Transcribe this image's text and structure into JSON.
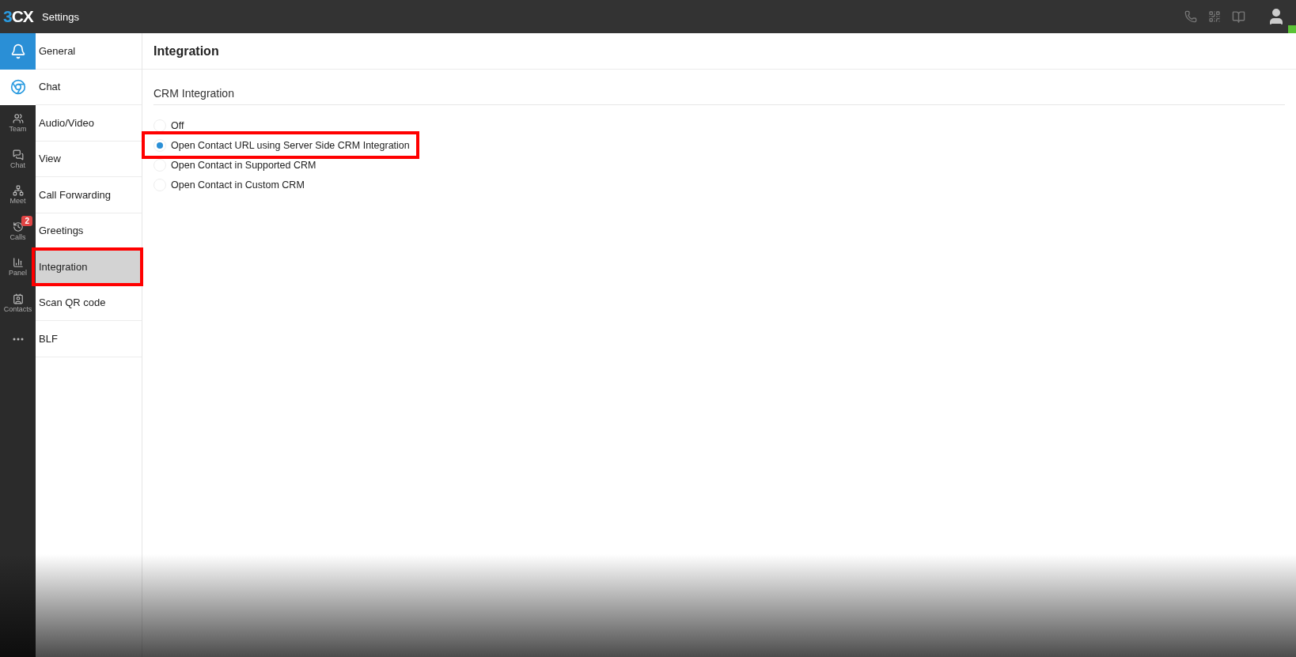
{
  "app_bar": {
    "logo_accent": "3",
    "logo_rest": "CX",
    "title": "Settings"
  },
  "rail": [
    {
      "kind": "bell",
      "selected": true
    },
    {
      "kind": "chrome",
      "selected": false
    },
    {
      "kind": "team",
      "label": "Team",
      "selected": false
    },
    {
      "kind": "chat",
      "label": "Chat",
      "selected": false
    },
    {
      "kind": "meet",
      "label": "Meet",
      "selected": false
    },
    {
      "kind": "calls",
      "label": "Calls",
      "selected": false,
      "badge": "2"
    },
    {
      "kind": "panel",
      "label": "Panel",
      "selected": false
    },
    {
      "kind": "contacts",
      "label": "Contacts",
      "selected": false
    },
    {
      "kind": "more",
      "selected": false
    }
  ],
  "settings_menu": [
    {
      "label": "General",
      "selected": false,
      "highlighted": false
    },
    {
      "label": "Chat",
      "selected": false,
      "highlighted": false
    },
    {
      "label": "Audio/Video",
      "selected": false,
      "highlighted": false
    },
    {
      "label": "View",
      "selected": false,
      "highlighted": false
    },
    {
      "label": "Call Forwarding",
      "selected": false,
      "highlighted": false
    },
    {
      "label": "Greetings",
      "selected": false,
      "highlighted": false
    },
    {
      "label": "Integration",
      "selected": true,
      "highlighted": true
    },
    {
      "label": "Scan QR code",
      "selected": false,
      "highlighted": false
    },
    {
      "label": "BLF",
      "selected": false,
      "highlighted": false
    }
  ],
  "page_title": "Integration",
  "section": {
    "title": "CRM Integration",
    "options": [
      {
        "label": "Off",
        "selected": false,
        "highlighted": false
      },
      {
        "label": "Open Contact URL using Server Side CRM Integration",
        "selected": true,
        "highlighted": true
      },
      {
        "label": "Open Contact in Supported CRM",
        "selected": false,
        "highlighted": false
      },
      {
        "label": "Open Contact in Custom CRM",
        "selected": false,
        "highlighted": false
      }
    ]
  }
}
